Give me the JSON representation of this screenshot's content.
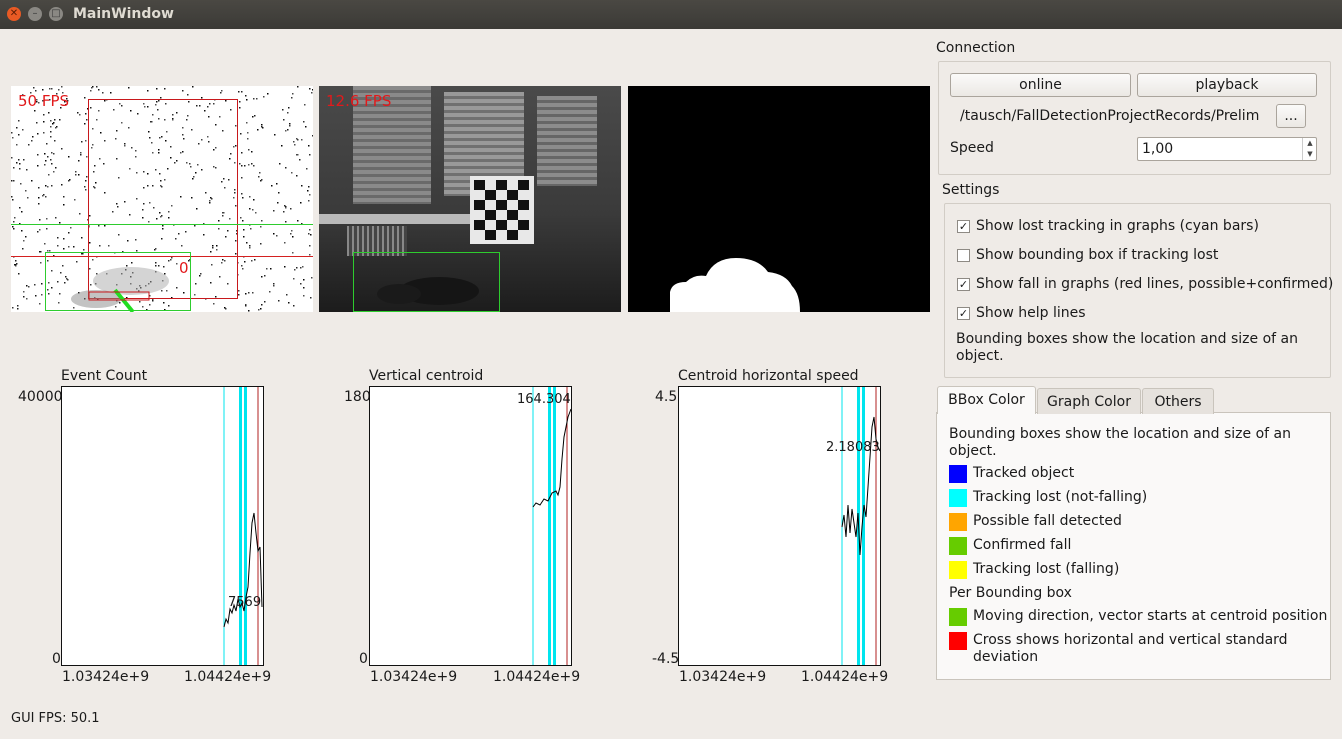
{
  "window": {
    "title": "MainWindow"
  },
  "views": {
    "event": {
      "fps": "50 FPS",
      "count": "0"
    },
    "gray": {
      "fps": "12.6 FPS"
    }
  },
  "plots": [
    {
      "title": "Event Count",
      "ymax": "40000",
      "ymin": "0",
      "x0": "1.03424e+9",
      "x1": "1.04424e+9",
      "annotation": "7569"
    },
    {
      "title": "Vertical centroid",
      "ymax": "180",
      "ymin": "0",
      "x0": "1.03424e+9",
      "x1": "1.04424e+9",
      "annotation": "164.304"
    },
    {
      "title": "Centroid horizontal speed",
      "ymax": "4.5",
      "ymin": "-4.5",
      "x0": "1.03424e+9",
      "x1": "1.04424e+9",
      "annotation": "2.18083"
    }
  ],
  "connection": {
    "title": "Connection",
    "online": "online",
    "playback": "playback",
    "path": "/tausch/FallDetectionProjectRecords/Prelim",
    "browse": "...",
    "speed_label": "Speed",
    "speed_value": "1,00"
  },
  "settings": {
    "title": "Settings",
    "items": [
      {
        "label": "Show lost tracking in graphs (cyan bars)",
        "checked": "✓"
      },
      {
        "label": "Show bounding box if tracking lost",
        "checked": ""
      },
      {
        "label": "Show fall in graphs (red lines, possible+confirmed)",
        "checked": "✓"
      },
      {
        "label": "Show help lines",
        "checked": "✓"
      }
    ],
    "note": "Bounding boxes show the location and size of an object."
  },
  "tabs": [
    "BBox Color",
    "Graph Color",
    "Others"
  ],
  "bbox_tab": {
    "intro": "Bounding boxes show the location and size of an object.",
    "legend": [
      {
        "label": "Tracked object",
        "color": "#0000ff"
      },
      {
        "label": "Tracking lost (not-falling)",
        "color": "#00ffff"
      },
      {
        "label": "Possible fall detected",
        "color": "#ffa500"
      },
      {
        "label": "Confirmed fall",
        "color": "#66cc00"
      },
      {
        "label": "Tracking lost (falling)",
        "color": "#ffff00"
      }
    ],
    "per_title": "Per Bounding box",
    "per_legend": [
      {
        "label": "Moving direction, vector starts at centroid position",
        "color": "#66cc00"
      },
      {
        "label": "Cross shows horizontal and vertical standard deviation",
        "color": "#ff0000"
      }
    ]
  },
  "status": {
    "gui_fps": "GUI FPS: 50.1"
  }
}
